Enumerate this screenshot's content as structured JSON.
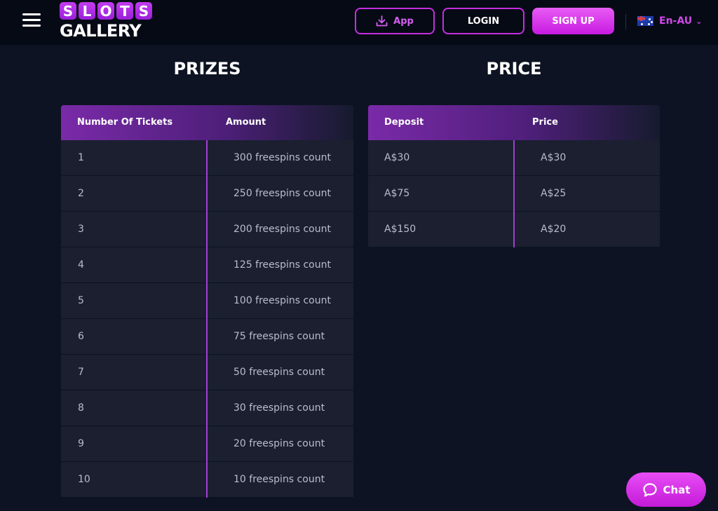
{
  "header": {
    "menu_icon": "hamburger-menu-icon",
    "logo": {
      "top_letters": [
        "S",
        "L",
        "O",
        "T",
        "S"
      ],
      "bottom": "GALLERY"
    },
    "app_button": {
      "label": "App",
      "icon": "download-icon"
    },
    "login_label": "LOGIN",
    "signup_label": "SIGN UP",
    "language": {
      "label": "En-AU",
      "flag": "australia-flag-icon",
      "chevron": "chevron-down-icon"
    }
  },
  "prizes": {
    "title": "PRIZES",
    "columns": [
      "Number Of Tickets",
      "Amount"
    ],
    "rows": [
      [
        "1",
        "300 freespins count"
      ],
      [
        "2",
        "250 freespins count"
      ],
      [
        "3",
        "200 freespins count"
      ],
      [
        "4",
        "125 freespins count"
      ],
      [
        "5",
        "100 freespins count"
      ],
      [
        "6",
        "75 freespins count"
      ],
      [
        "7",
        "50 freespins count"
      ],
      [
        "8",
        "30 freespins count"
      ],
      [
        "9",
        "20 freespins count"
      ],
      [
        "10",
        "10 freespins count"
      ]
    ]
  },
  "price": {
    "title": "PRICE",
    "columns": [
      "Deposit",
      "Price"
    ],
    "rows": [
      [
        "A$30",
        "A$30"
      ],
      [
        "A$75",
        "A$25"
      ],
      [
        "A$150",
        "A$20"
      ]
    ]
  },
  "chat": {
    "label": "Chat",
    "icon": "chat-bubble-icon"
  },
  "colors": {
    "background": "#0d1322",
    "header": "#060a15",
    "accent": "#c52ee0",
    "row": "#1b1f30",
    "divider": "#a33fd3"
  }
}
